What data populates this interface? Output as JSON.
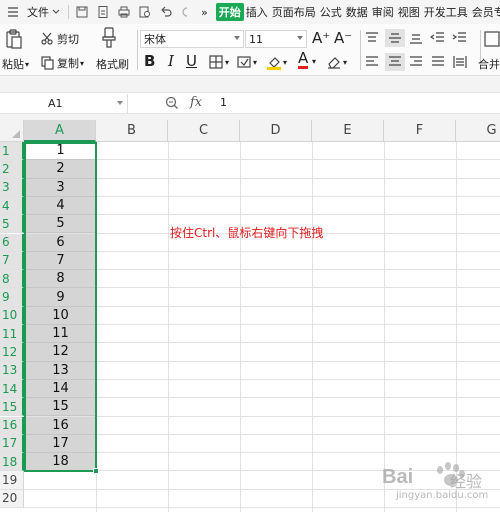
{
  "menubar": {
    "file_label": "文件",
    "tabs": [
      "开始",
      "插入",
      "页面布局",
      "公式",
      "数据",
      "审阅",
      "视图",
      "开发工具",
      "会员专享"
    ],
    "active_tab": "开始",
    "more_glyph": "»"
  },
  "ribbon": {
    "paste_label": "粘贴",
    "cut_label": "剪切",
    "copy_label": "复制",
    "format_painter_label": "格式刷",
    "font_name": "宋体",
    "font_size": "11",
    "merge_label": "合并",
    "bold_glyph": "B",
    "italic_glyph": "I",
    "underline_glyph": "U",
    "font_color_glyph": "A",
    "grow_font_glyph": "A⁺",
    "shrink_font_glyph": "A⁻"
  },
  "formula_bar": {
    "name_box": "A1",
    "fx_label": "fx",
    "value": "1"
  },
  "sheet": {
    "columns": [
      "A",
      "B",
      "C",
      "D",
      "E",
      "F",
      "G"
    ],
    "rows": [
      "1",
      "2",
      "3",
      "4",
      "5",
      "6",
      "7",
      "8",
      "9",
      "10",
      "11",
      "12",
      "13",
      "14",
      "15",
      "16",
      "17",
      "18",
      "19",
      "20"
    ],
    "column_a_values": [
      "1",
      "2",
      "3",
      "4",
      "5",
      "6",
      "7",
      "8",
      "9",
      "10",
      "11",
      "12",
      "13",
      "14",
      "15",
      "16",
      "17",
      "18"
    ],
    "annotation": "按住Ctrl、鼠标右键向下拖拽"
  },
  "watermark": {
    "brand": "Bai",
    "brand_tail": "经验",
    "url": "jingyan.baidu.com"
  },
  "colors": {
    "accent": "#1aaa55",
    "selection_fill": "#d5d5d5",
    "annotation": "#e02020"
  }
}
